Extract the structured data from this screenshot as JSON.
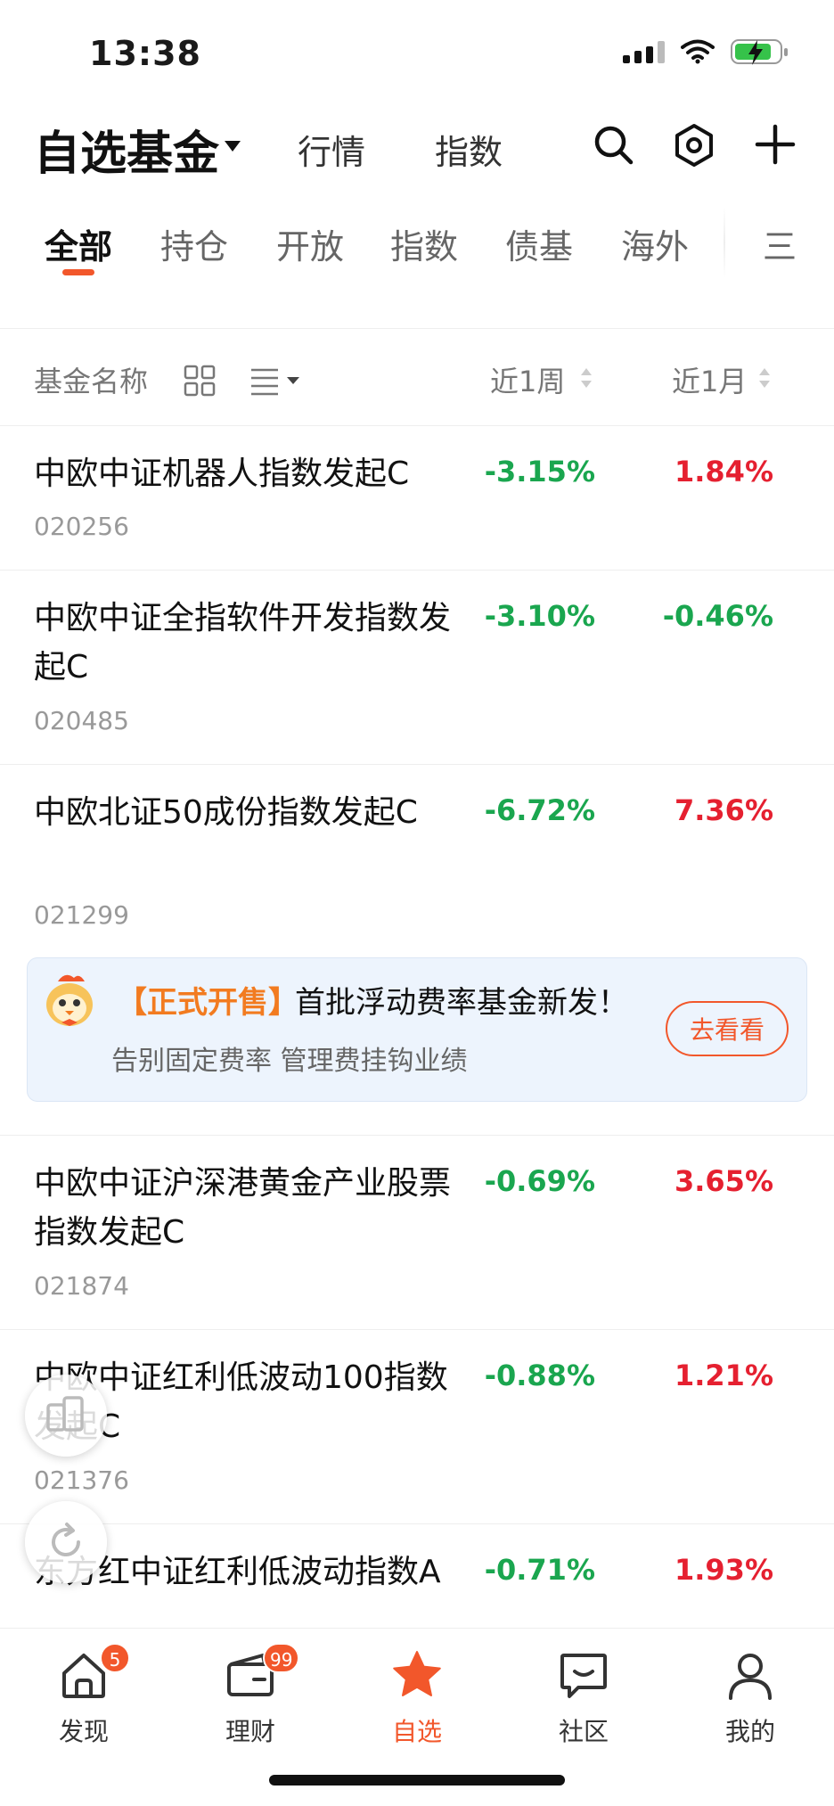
{
  "status_bar": {
    "time": "13:38"
  },
  "header": {
    "title": "自选基金",
    "tabs": [
      "行情",
      "指数"
    ],
    "icons": [
      "search-icon",
      "settings-hex-icon",
      "plus-icon"
    ]
  },
  "category_tabs": [
    "全部",
    "持仓",
    "开放",
    "指数",
    "债基",
    "海外",
    "三"
  ],
  "column_header": {
    "fund_name": "基金名称",
    "week": "近1周",
    "month": "近1月"
  },
  "funds": [
    {
      "name": "中欧中证机器人指数发起C",
      "code": "020256",
      "week": "-3.15%",
      "month": "1.84%"
    },
    {
      "name": "中欧中证全指软件开发指数发起C",
      "code": "020485",
      "week": "-3.10%",
      "month": "-0.46%"
    },
    {
      "name": "中欧北证50成份指数发起C",
      "code": "021299",
      "week": "-6.72%",
      "month": "7.36%"
    },
    {
      "name": "中欧中证沪深港黄金产业股票指数发起C",
      "code": "021874",
      "week": "-0.69%",
      "month": "3.65%"
    },
    {
      "name": "中欧中证红利低波动100指数发起C",
      "code": "021376",
      "week": "-0.88%",
      "month": "1.21%"
    },
    {
      "name": "东方红中证红利低波动指数A",
      "code": "",
      "week": "-0.71%",
      "month": "1.93%"
    }
  ],
  "promo": {
    "tag": "【正式开售】",
    "title": "首批浮动费率基金新发！",
    "subtitle": "告别固定费率 管理费挂钩业绩",
    "button": "去看看"
  },
  "bottom_nav": {
    "items": [
      {
        "label": "发现",
        "badge": "5",
        "icon": "home-icon"
      },
      {
        "label": "理财",
        "badge": "99",
        "icon": "wallet-icon"
      },
      {
        "label": "自选",
        "badge": "",
        "icon": "star-icon"
      },
      {
        "label": "社区",
        "badge": "",
        "icon": "chat-icon"
      },
      {
        "label": "我的",
        "badge": "",
        "icon": "profile-icon"
      }
    ]
  },
  "colors": {
    "accent": "#f2572b",
    "up": "#e52030",
    "down": "#1aa64f"
  }
}
